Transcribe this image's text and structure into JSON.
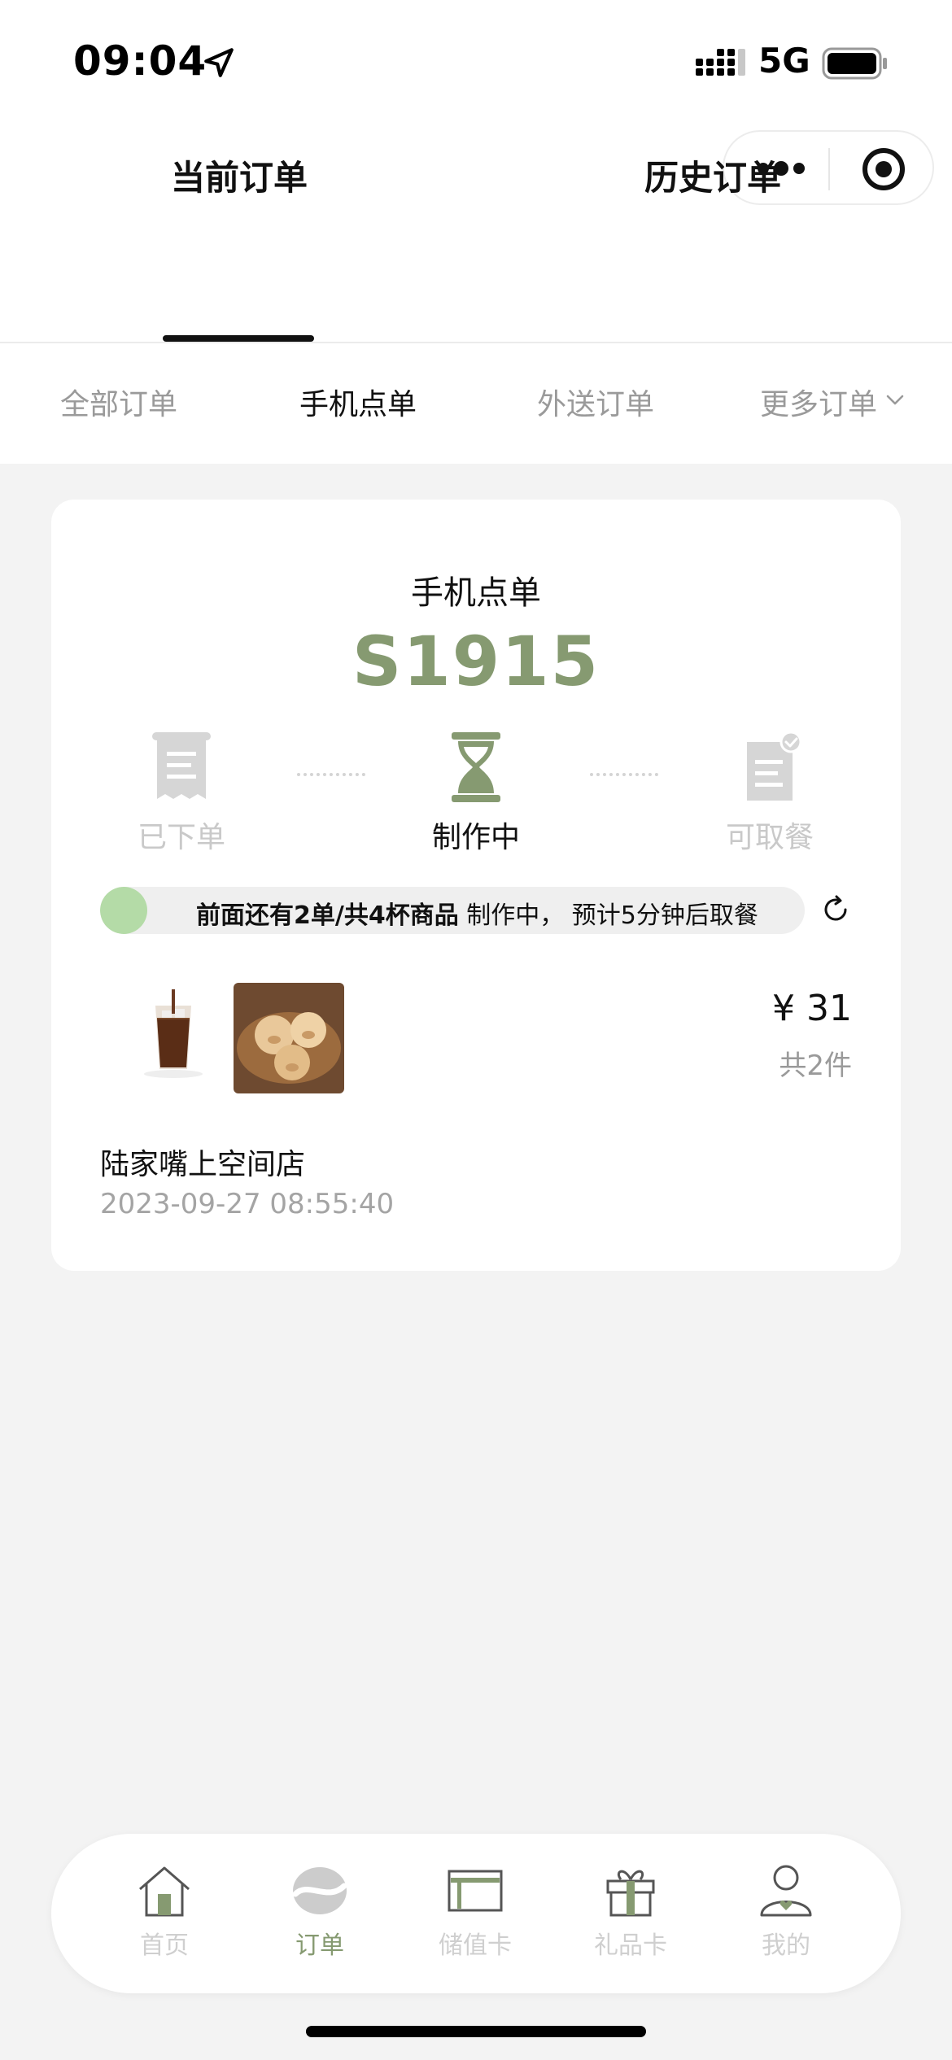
{
  "status_bar": {
    "time": "09:04",
    "network": "5G",
    "icons": [
      "location-arrow-icon",
      "signal-icon",
      "battery-icon"
    ]
  },
  "capsule": {
    "icons": [
      "more-dots-icon",
      "target-icon"
    ]
  },
  "main_tabs": [
    {
      "label": "当前订单",
      "active": true
    },
    {
      "label": "历史订单",
      "active": false
    }
  ],
  "sub_tabs": [
    {
      "label": "全部订单",
      "active": false
    },
    {
      "label": "手机点单",
      "active": true
    },
    {
      "label": "外送订单",
      "active": false
    },
    {
      "label": "更多订单",
      "active": false
    }
  ],
  "order": {
    "type": "手机点单",
    "pickup_code": "S1915",
    "steps": [
      {
        "label": "已下单",
        "icon": "receipt-icon"
      },
      {
        "label": "制作中",
        "icon": "hourglass-icon"
      },
      {
        "label": "可取餐",
        "icon": "ready-document-icon"
      }
    ],
    "progress_fraction": 0.06,
    "progress_text_bold": "前面还有2单/共4杯商品",
    "progress_text_rest": " 制作中， 预计5分钟后取餐",
    "price": "¥ 31",
    "count": "共2件",
    "store": "陆家嘴上空间店",
    "time": "2023-09-27 08:55:40"
  },
  "tab_bar": [
    {
      "label": "首页",
      "icon": "home-icon",
      "active": false
    },
    {
      "label": "订单",
      "icon": "coffee-bean-icon",
      "active": true
    },
    {
      "label": "储值卡",
      "icon": "card-icon",
      "active": false
    },
    {
      "label": "礼品卡",
      "icon": "gift-icon",
      "active": false
    },
    {
      "label": "我的",
      "icon": "person-icon",
      "active": false
    }
  ],
  "colors": {
    "accent": "#869a71",
    "progress": "#b4dba7",
    "background": "#f3f3f3"
  }
}
